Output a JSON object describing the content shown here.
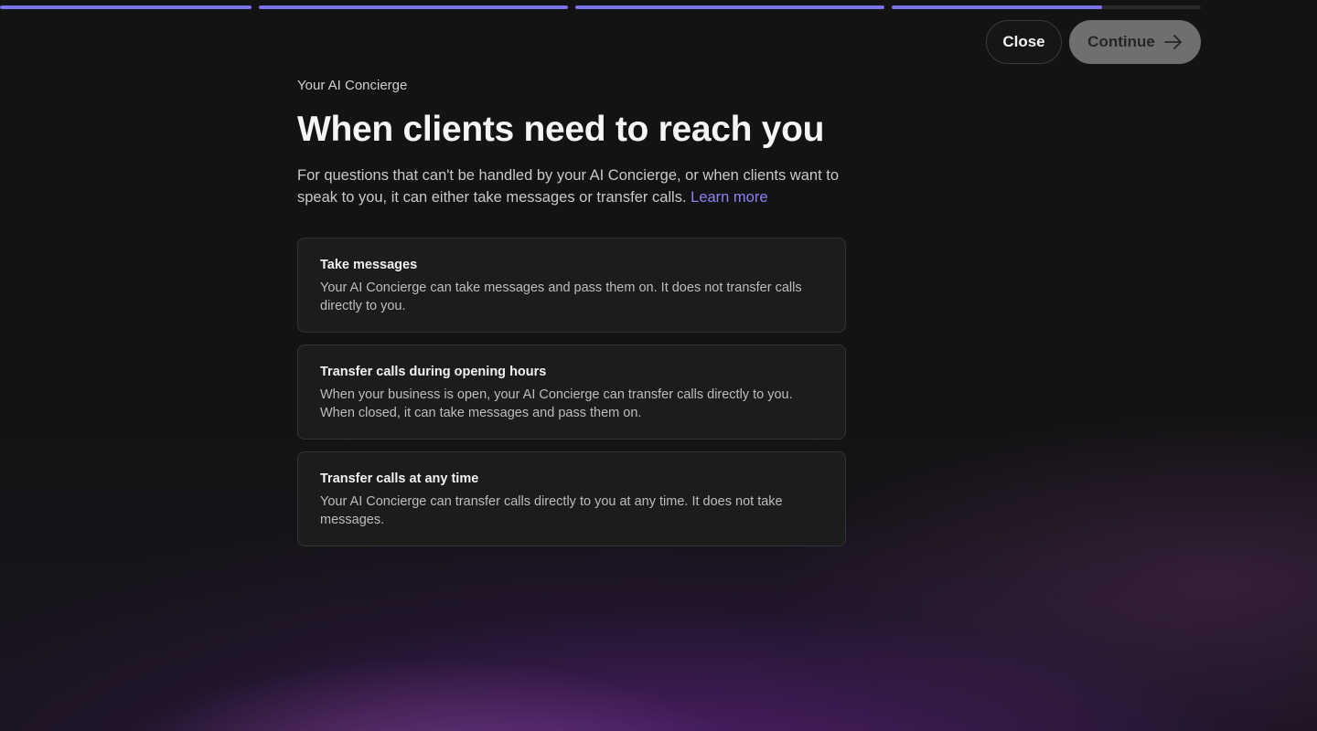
{
  "progress": {
    "segments": [
      {
        "fill": 1.0
      },
      {
        "fill": 1.0
      },
      {
        "fill": 1.0
      },
      {
        "fill": 0.68
      }
    ],
    "accent_color": "#7c74e6"
  },
  "actions": {
    "close_label": "Close",
    "continue_label": "Continue",
    "continue_icon": "arrow-right-icon"
  },
  "header": {
    "eyebrow": "Your AI Concierge",
    "title": "When clients need to reach you",
    "description": "For questions that can't be handled by your AI Concierge, or when clients want to speak to you, it can either take messages or transfer calls.",
    "learn_more": "Learn more"
  },
  "options": [
    {
      "title": "Take messages",
      "description": "Your AI Concierge can take messages and pass them on. It does not transfer calls directly to you."
    },
    {
      "title": "Transfer calls during opening hours",
      "description": "When your business is open, your AI Concierge can transfer calls directly to you. When closed, it can take messages and pass them on."
    },
    {
      "title": "Transfer calls at any time",
      "description": "Your AI Concierge can transfer calls directly to you at any time. It does not take messages."
    }
  ]
}
